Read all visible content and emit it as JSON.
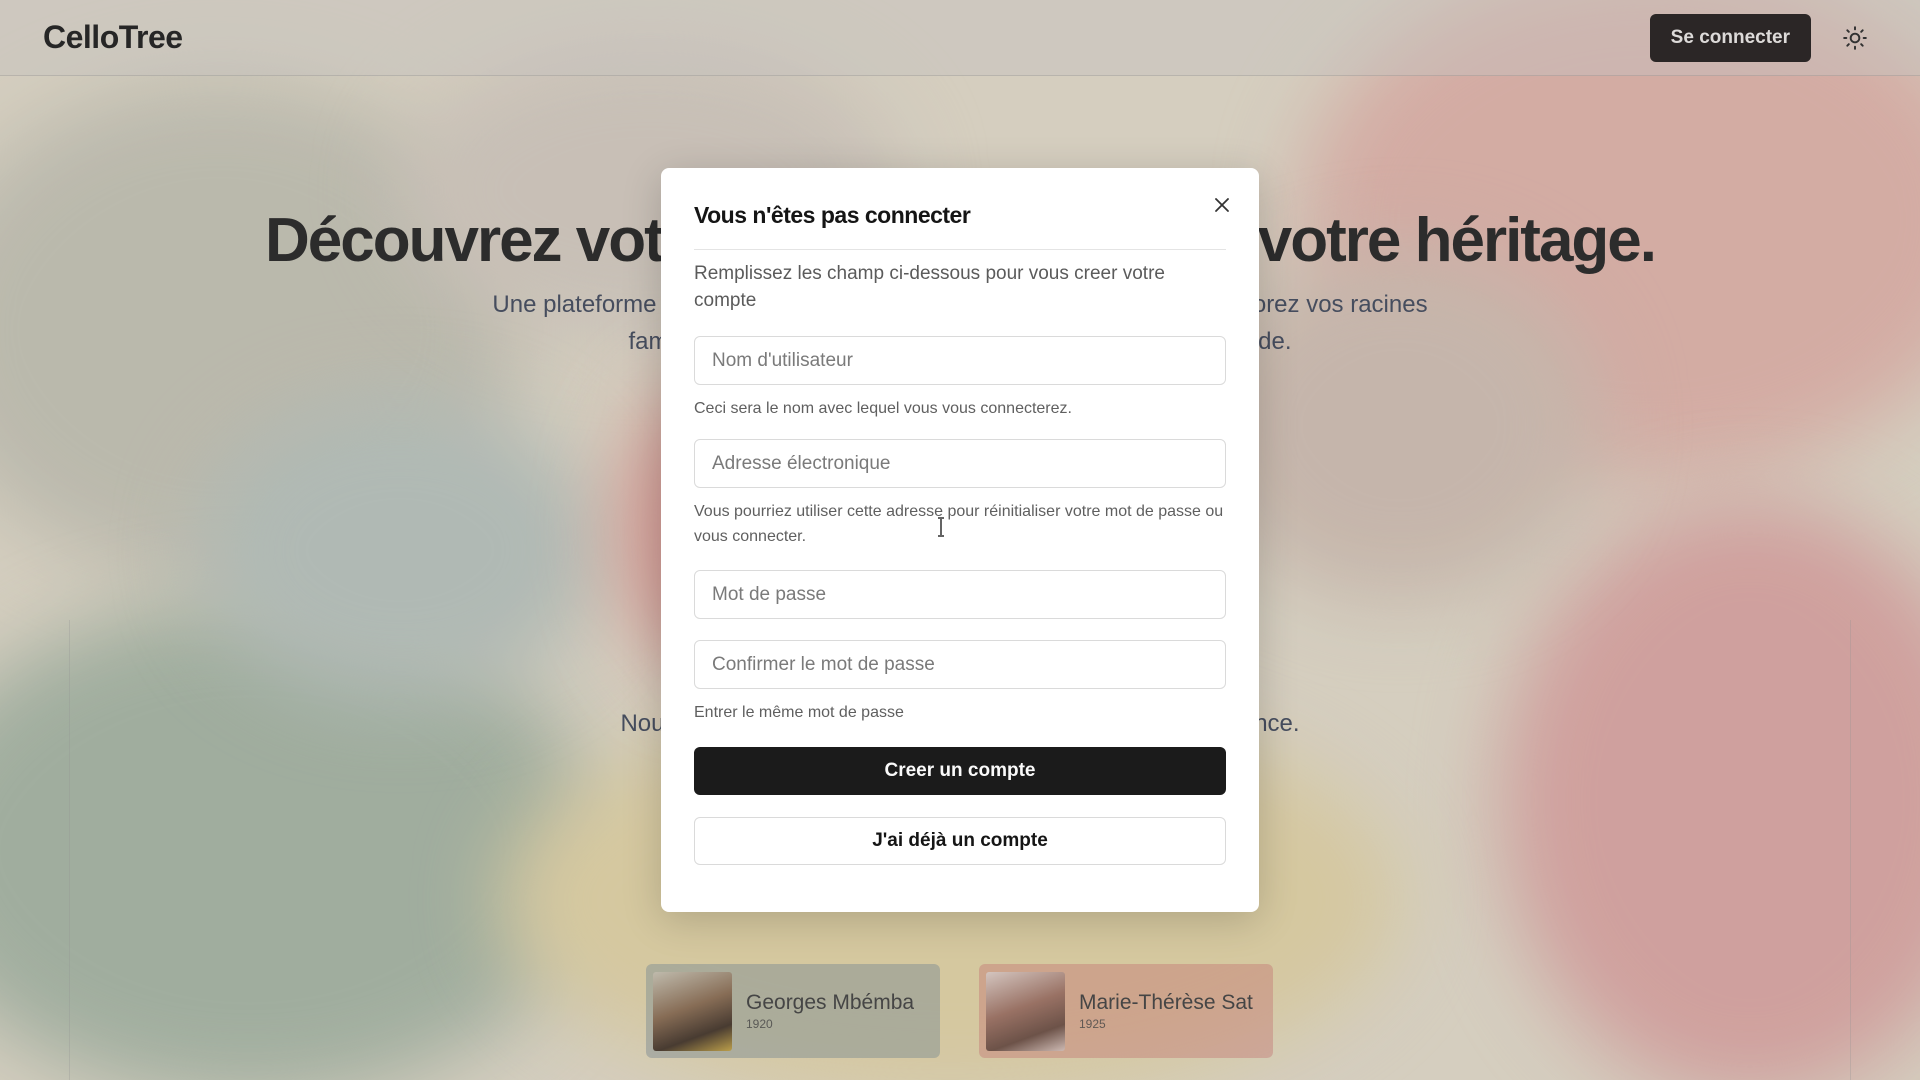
{
  "app": {
    "logo": "CelloTree",
    "login_button": "Se connecter",
    "theme_icon": "sun-icon"
  },
  "hero": {
    "title": "Découvrez votre histoire, préservez votre héritage.",
    "subtitle": "Une plateforme intuitive pour construire vos arbres généalogiques. Explorez vos racines familiales et connectez-vous avec des familles dans le monde.",
    "subtitle2": "Nous vous accompagnons à chaque étape de votre expérience."
  },
  "people": [
    {
      "name": "Georges Mbémba",
      "year": "1920"
    },
    {
      "name": "Marie-Thérèse Sat",
      "year": "1925"
    }
  ],
  "dialog": {
    "title": "Vous n'êtes pas connecter",
    "description": "Remplissez les champ ci-dessous pour vous creer votre compte",
    "username": {
      "placeholder": "Nom d'utilisateur",
      "value": "",
      "hint": "Ceci sera le nom avec lequel vous vous connecterez."
    },
    "email": {
      "placeholder": "Adresse électronique",
      "value": "",
      "hint": "Vous pourriez utiliser cette adresse pour réinitialiser votre mot de passe ou vous connecter."
    },
    "password": {
      "placeholder": "Mot de passe",
      "value": ""
    },
    "confirm_password": {
      "placeholder": "Confirmer le mot de passe",
      "value": "",
      "hint": "Entrer le même mot de passe"
    },
    "create_button": "Creer un compte",
    "have_account_button": "J'ai déjà un compte",
    "close_icon": "close-icon"
  },
  "colors": {
    "primary_button": "#1b1b1b",
    "login_button": "#1a1414"
  }
}
